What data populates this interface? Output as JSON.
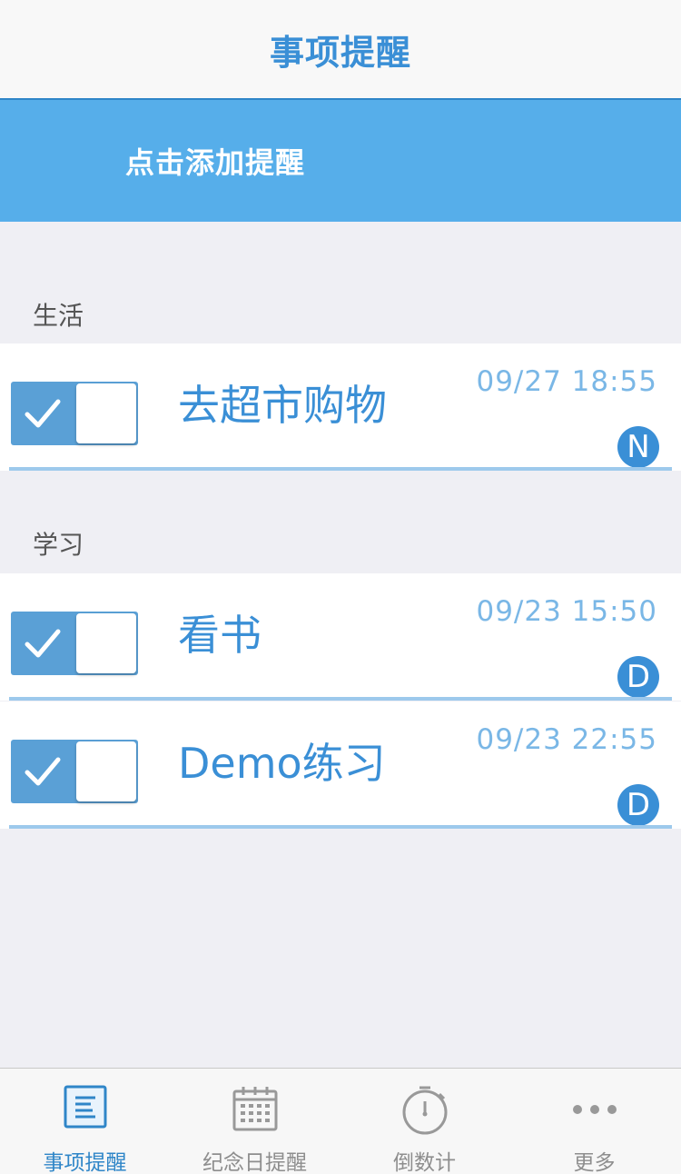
{
  "navbar": {
    "title": "事项提醒"
  },
  "banner": {
    "label": "点击添加提醒"
  },
  "sections": [
    {
      "header": "生活",
      "items": [
        {
          "title": "去超市购物",
          "time": "09/27 18:55",
          "badge": "N",
          "enabled": true
        }
      ]
    },
    {
      "header": "学习",
      "items": [
        {
          "title": "看书",
          "time": "09/23 15:50",
          "badge": "D",
          "enabled": true
        },
        {
          "title": "Demo练习",
          "time": "09/23 22:55",
          "badge": "D",
          "enabled": true
        }
      ]
    }
  ],
  "tabbar": {
    "tabs": [
      {
        "label": "事项提醒",
        "icon": "list-icon",
        "active": true
      },
      {
        "label": "纪念日提醒",
        "icon": "calendar-icon",
        "active": false
      },
      {
        "label": "倒数计",
        "icon": "stopwatch-icon",
        "active": false
      },
      {
        "label": "更多",
        "icon": "more-icon",
        "active": false
      }
    ]
  },
  "colors": {
    "accent": "#3a8fd6",
    "banner": "#56aeea",
    "background": "#efeff4",
    "toggle_on": "#5aa0d6",
    "time_text": "#7ab7e6"
  }
}
